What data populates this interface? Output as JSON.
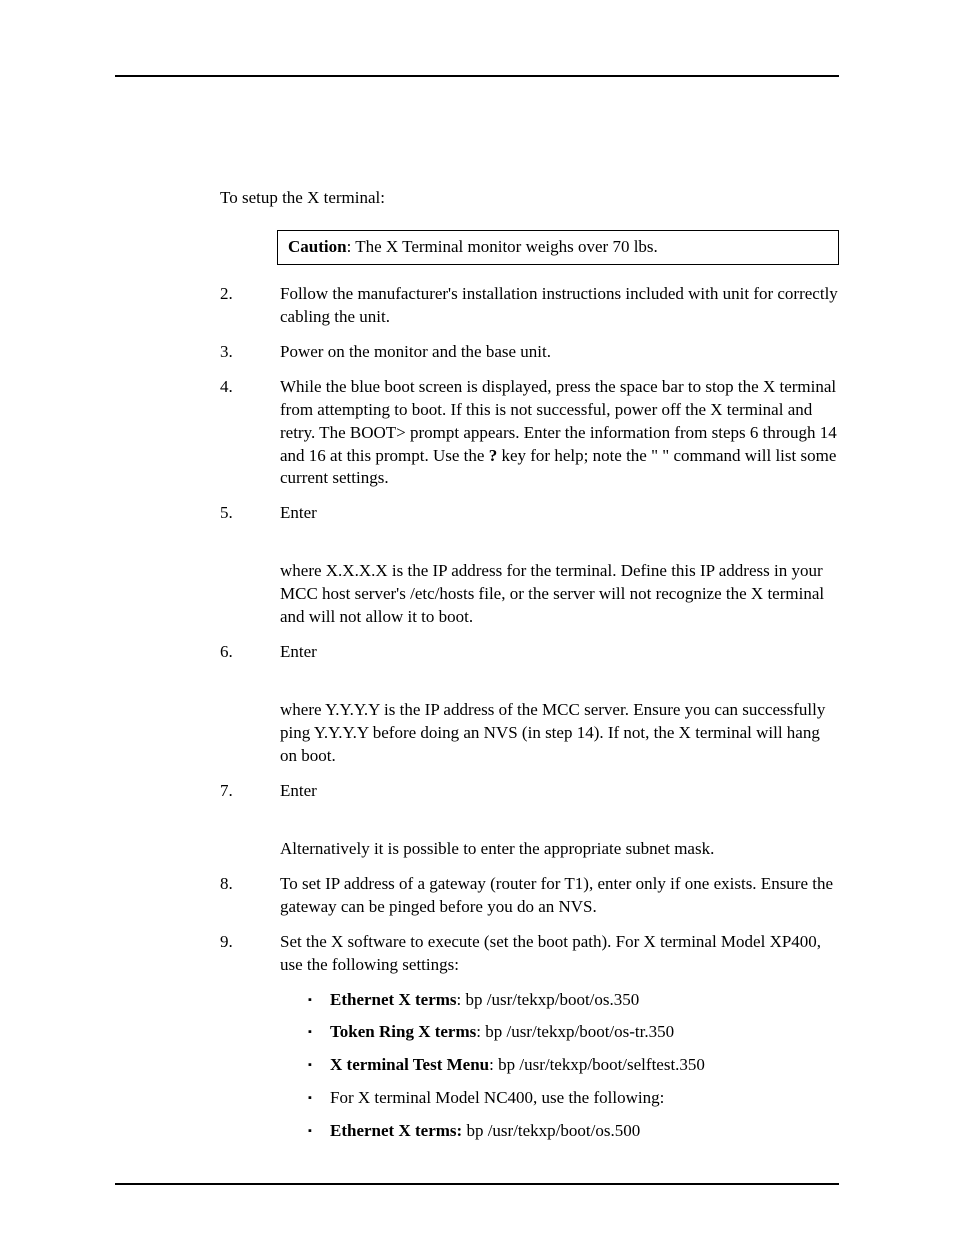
{
  "intro": "To setup the X terminal:",
  "caution": {
    "label": "Caution",
    "text": ": The X Terminal monitor weighs over 70 lbs."
  },
  "steps": {
    "s2": "Follow the manufacturer's installation instructions included with unit for correctly cabling the unit.",
    "s3": "Power on the monitor and the base unit.",
    "s4_a": "While the blue boot screen is displayed, press the space bar to stop the X terminal from attempting to boot. If this is not successful, power off the X terminal and retry. The BOOT> prompt appears. Enter the information from steps 6 through 14 and 16 at this prompt. Use the ",
    "s4_b": "?",
    "s4_c": " key for help; note the \"    \" command will list some current settings.",
    "s5": "Enter",
    "s5_sub": "where X.X.X.X is the IP address for the terminal. Define this IP address in your MCC host server's /etc/hosts file, or the server will not recognize the X terminal and will not allow it to boot.",
    "s6": "Enter",
    "s6_sub": "where Y.Y.Y.Y is the IP address of the MCC server. Ensure you can successfully ping Y.Y.Y.Y before doing an NVS (in step 14). If not, the X terminal will hang on boot.",
    "s7": "Enter",
    "s7_sub": "Alternatively it is possible to enter the appropriate subnet mask.",
    "s8": "To set IP address of a gateway (router for T1), enter only if one exists. Ensure the gateway can be pinged before you do an NVS.",
    "s9": "Set the X software to execute (set the boot path). For X terminal Model XP400, use the following settings:",
    "bullets": {
      "b1_label": "Ethernet X terms",
      "b1_text": ": bp /usr/tekxp/boot/os.350",
      "b2_label": "Token Ring X terms",
      "b2_text": ": bp /usr/tekxp/boot/os-tr.350",
      "b3_label": "X terminal Test Menu",
      "b3_text": ": bp /usr/tekxp/boot/selftest.350",
      "b4_text": "For X terminal Model NC400, use the following:",
      "b5_label": "Ethernet X terms:",
      "b5_text": " bp /usr/tekxp/boot/os.500"
    }
  }
}
